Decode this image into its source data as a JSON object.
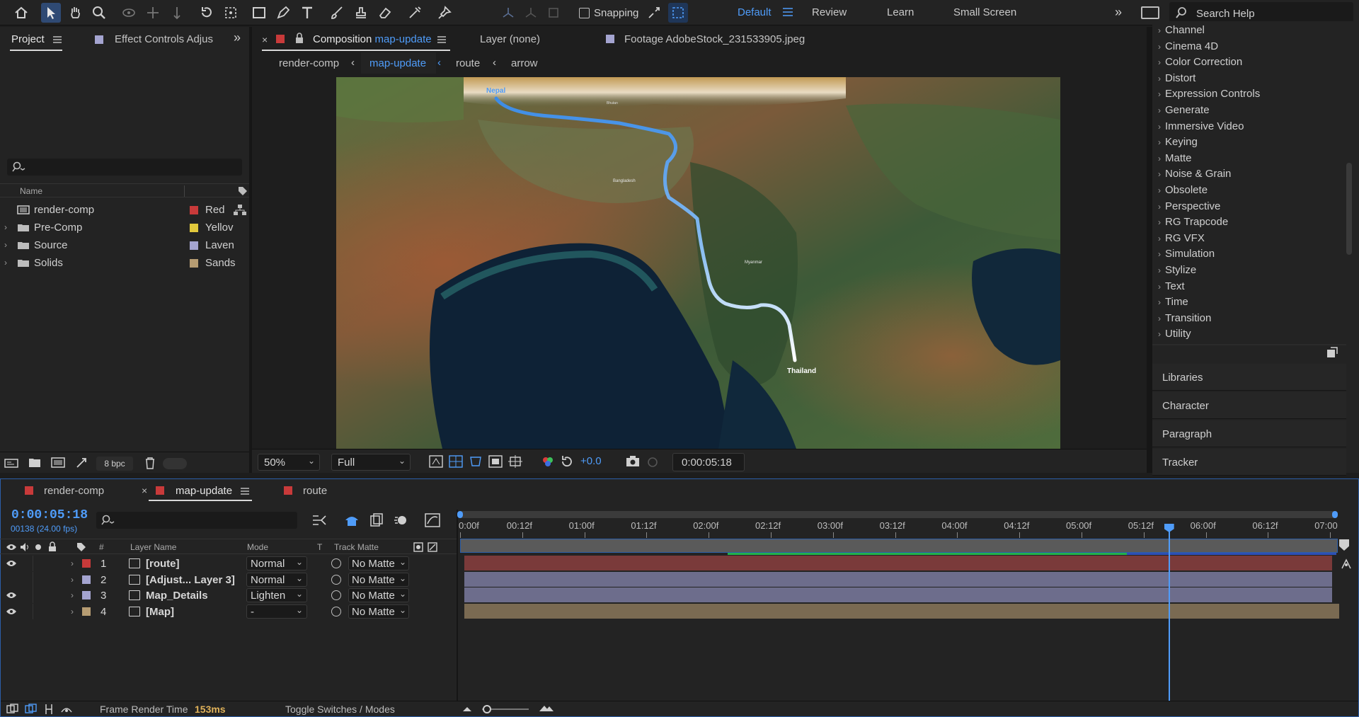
{
  "toolbar": {
    "snapping_label": "Snapping",
    "workspaces": [
      "Default",
      "Review",
      "Learn",
      "Small Screen"
    ],
    "active_workspace": "Default",
    "search_placeholder": "Search Help"
  },
  "project": {
    "tabs": [
      "Project",
      "Effect Controls Adjus"
    ],
    "column_name": "Name",
    "items": [
      {
        "name": "render-comp",
        "label": "Red",
        "color": "#c83a3a",
        "type": "composition"
      },
      {
        "name": "Pre-Comp",
        "label": "Yellov",
        "color": "#e1c83c",
        "type": "folder"
      },
      {
        "name": "Source",
        "label": "Laven",
        "color": "#a4a4d0",
        "type": "folder"
      },
      {
        "name": "Solids",
        "label": "Sands",
        "color": "#b69c72",
        "type": "folder"
      }
    ],
    "bpc": "8 bpc"
  },
  "viewer": {
    "comp_tab_prefix": "Composition",
    "comp_name": "map-update",
    "layer_tab": "Layer (none)",
    "footage_tab": "Footage AdobeStock_231533905.jpeg",
    "breadcrumbs": [
      "render-comp",
      "map-update",
      "route",
      "arrow"
    ],
    "zoom": "50%",
    "resolution": "Full",
    "exposure": "+0.0",
    "timecode": "0:00:05:18",
    "map_labels": {
      "start": "Nepal",
      "end": "Thailand",
      "bhutan": "Bhutan",
      "bangladesh": "Bangladesh",
      "myanmar": "Myanmar"
    }
  },
  "effects": {
    "categories": [
      "Channel",
      "Cinema 4D",
      "Color Correction",
      "Distort",
      "Expression Controls",
      "Generate",
      "Immersive Video",
      "Keying",
      "Matte",
      "Noise & Grain",
      "Obsolete",
      "Perspective",
      "RG Trapcode",
      "RG VFX",
      "Simulation",
      "Stylize",
      "Text",
      "Time",
      "Transition",
      "Utility"
    ]
  },
  "side_panels": [
    "Libraries",
    "Character",
    "Paragraph",
    "Tracker"
  ],
  "timeline": {
    "tabs": [
      {
        "name": "render-comp",
        "color": "#c83a3a"
      },
      {
        "name": "map-update",
        "color": "#c83a3a"
      },
      {
        "name": "route",
        "color": "#c83a3a"
      }
    ],
    "timecode": "0:00:05:18",
    "frame_info": "00138 (24.00 fps)",
    "columns": {
      "num": "#",
      "layer_name": "Layer Name",
      "mode": "Mode",
      "t": "T",
      "track_matte": "Track Matte"
    },
    "ruler": [
      "0:00f",
      "00:12f",
      "01:00f",
      "01:12f",
      "02:00f",
      "02:12f",
      "03:00f",
      "03:12f",
      "04:00f",
      "04:12f",
      "05:00f",
      "05:12f",
      "06:00f",
      "06:12f",
      "07:00"
    ],
    "playhead_seconds": 5.75,
    "layers": [
      {
        "num": "1",
        "name": "[route]",
        "mode": "Normal",
        "matte": "No Matte",
        "color": "#c83a3a",
        "bar_color": "#7a3a3a"
      },
      {
        "num": "2",
        "name": "[Adjust... Layer 3]",
        "mode": "Normal",
        "matte": "No Matte",
        "color": "#a4a4d0",
        "bar_color": "#6d6d8c"
      },
      {
        "num": "3",
        "name": "Map_Details",
        "mode": "Lighten",
        "matte": "No Matte",
        "color": "#a4a4d0",
        "bar_color": "#6d6d8c"
      },
      {
        "num": "4",
        "name": "[Map]",
        "mode": "-",
        "matte": "No Matte",
        "color": "#b69c72",
        "bar_color": "#7a6a52"
      }
    ],
    "footer": {
      "frame_render_label": "Frame Render Time",
      "frame_render_value": "153ms",
      "toggle_label": "Toggle Switches / Modes"
    }
  }
}
